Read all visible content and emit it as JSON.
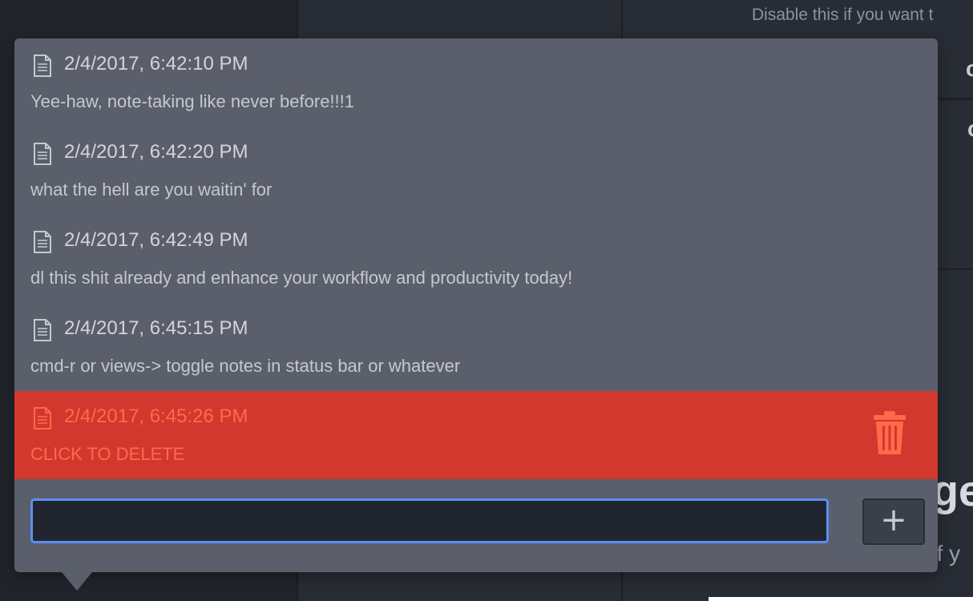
{
  "background": {
    "hint_text": "Disable this if you want t",
    "fragment_1": "c",
    "fragment_2": "c",
    "title_fragment": "ge",
    "subtitle_fragment": "of y"
  },
  "notes": [
    {
      "timestamp": "2/4/2017, 6:42:10 PM",
      "text": "Yee-haw, note-taking like never before!!!1",
      "icon": "document-icon"
    },
    {
      "timestamp": "2/4/2017, 6:42:20 PM",
      "text": "what the hell are you waitin' for",
      "icon": "document-icon"
    },
    {
      "timestamp": "2/4/2017, 6:42:49 PM",
      "text": "dl this shit already and enhance your workflow and productivity today!",
      "icon": "document-icon"
    },
    {
      "timestamp": "2/4/2017, 6:45:15 PM",
      "text": "cmd-r or views-> toggle notes in status bar or whatever",
      "icon": "document-icon"
    },
    {
      "timestamp": "2/4/2017, 6:45:26 PM",
      "text": "CLICK TO DELETE",
      "icon": "document-icon",
      "state": "hover-delete",
      "action_icon": "trash-icon"
    }
  ],
  "input": {
    "value": "",
    "placeholder": ""
  },
  "add_button": {
    "label": "+"
  },
  "colors": {
    "popover_bg": "#5b5f6b",
    "delete_bg": "#d2382e",
    "delete_text": "#ff6a4a",
    "input_focus": "#5c8ff4"
  }
}
